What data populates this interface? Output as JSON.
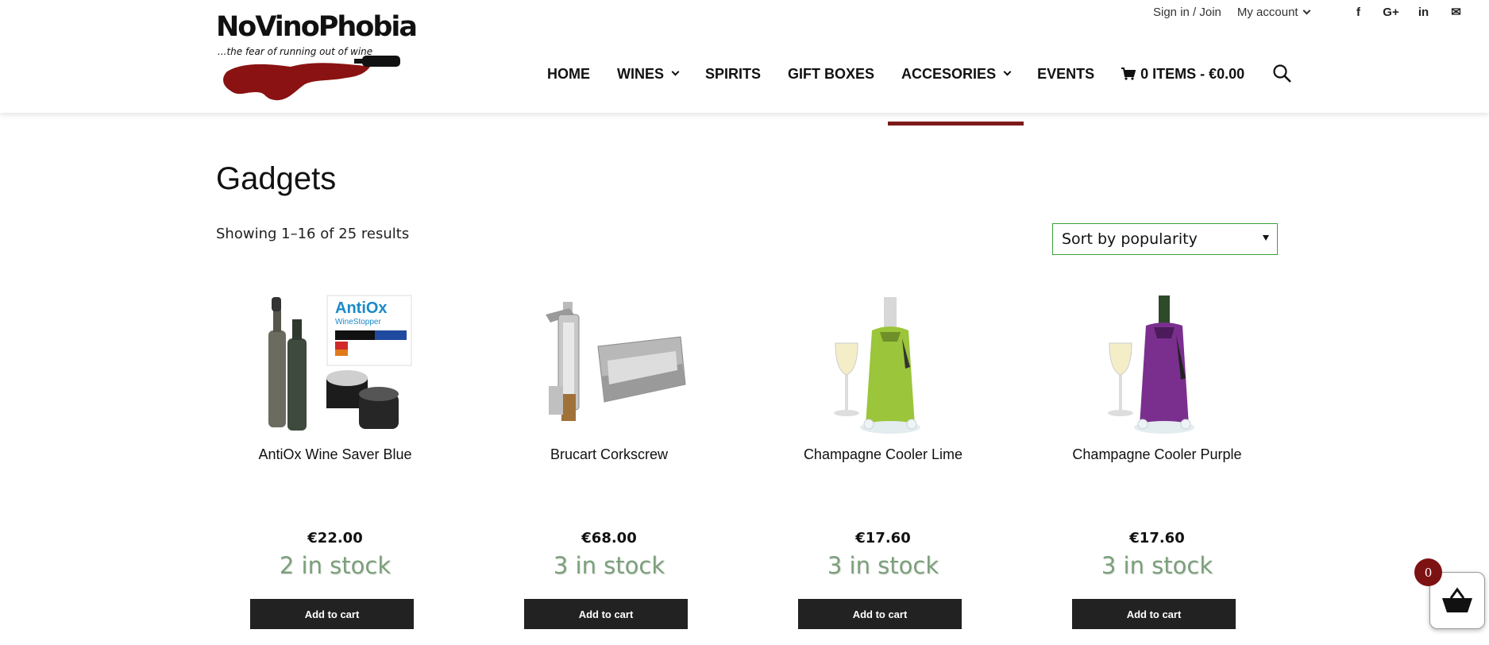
{
  "brand": {
    "name": "NoVinoPhobia",
    "tagline": "...the fear of running out of wine"
  },
  "top_links": {
    "sign_in": "Sign in / Join",
    "my_account": "My account"
  },
  "social": [
    {
      "icon": "facebook-icon",
      "glyph": "f"
    },
    {
      "icon": "google-plus-icon",
      "glyph": "G+"
    },
    {
      "icon": "linkedin-icon",
      "glyph": "in"
    },
    {
      "icon": "mail-icon",
      "glyph": "✉"
    }
  ],
  "nav": {
    "home": "HOME",
    "wines": "WINES",
    "spirits": "SPIRITS",
    "gift_boxes": "GIFT BOXES",
    "accessories": "ACCESORIES",
    "events": "EVENTS",
    "cart": "0 ITEMS - €0.00"
  },
  "page": {
    "title": "Gadgets",
    "result_count": "Showing 1–16 of 25 results",
    "sort_selected": "Sort by popularity"
  },
  "products": [
    {
      "name": "AntiOx Wine Saver Blue",
      "price": "€22.00",
      "stock": "2 in stock",
      "button": "Add to cart",
      "image_text": "AntiOx",
      "image_subtext": "WineStopper"
    },
    {
      "name": "Brucart Corkscrew",
      "price": "€68.00",
      "stock": "3 in stock",
      "button": "Add to cart"
    },
    {
      "name": "Champagne Cooler Lime",
      "price": "€17.60",
      "stock": "3 in stock",
      "button": "Add to cart"
    },
    {
      "name": "Champagne Cooler Purple",
      "price": "€17.60",
      "stock": "3 in stock",
      "button": "Add to cart"
    }
  ],
  "mini_cart": {
    "count": "0"
  },
  "colors": {
    "accent": "#7d1a1a",
    "stock_green": "#7ba07b",
    "button_dark": "#222222",
    "sort_border": "#3aa23a"
  }
}
